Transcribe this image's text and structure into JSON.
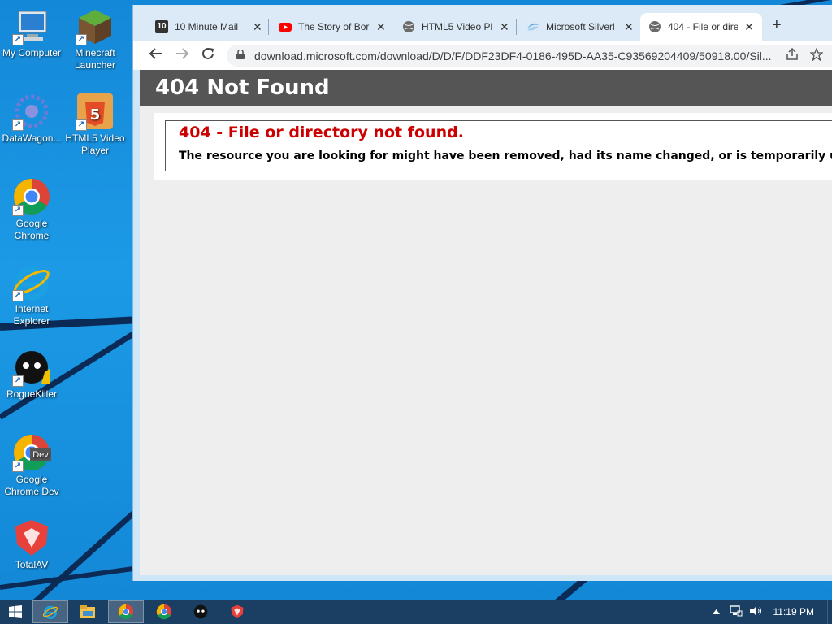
{
  "desktop": {
    "icons": [
      {
        "label": "My Computer",
        "icon": "computer-icon"
      },
      {
        "label": "Minecraft Launcher",
        "icon": "minecraft-icon"
      },
      {
        "label": "DataWagon...",
        "icon": "datawagon-icon"
      },
      {
        "label": "HTML5 Video Player",
        "icon": "html5-icon"
      },
      {
        "label": "Google Chrome",
        "icon": "chrome-icon"
      },
      {
        "label": "Internet Explorer",
        "icon": "ie-icon"
      },
      {
        "label": "RogueKiller",
        "icon": "roguekiller-icon"
      },
      {
        "label": "Google Chrome Dev",
        "icon": "chrome-dev-icon"
      },
      {
        "label": "TotalAV",
        "icon": "totalav-icon"
      }
    ]
  },
  "browser": {
    "tabs": [
      {
        "title": "10 Minute Mail",
        "icon": "tenminutemail-icon",
        "active": false
      },
      {
        "title": "The Story of Bor",
        "icon": "youtube-icon",
        "active": false
      },
      {
        "title": "HTML5 Video Pl",
        "icon": "globe-icon",
        "active": false
      },
      {
        "title": "Microsoft Silverl",
        "icon": "silverlight-icon",
        "active": false
      },
      {
        "title": "404 - File or dire",
        "icon": "globe-icon",
        "active": true
      }
    ],
    "new_tab_label": "+",
    "close_glyph": "✕",
    "url": "download.microsoft.com/download/D/D/F/DDF23DF4-0186-495D-AA35-C93569204409/50918.00/Sil...",
    "favicon_text": "10"
  },
  "page": {
    "header": "404 Not Found",
    "error_title": "404 - File or directory not found.",
    "error_description": "The resource you are looking for might have been removed, had its name changed, or is temporarily unavailable."
  },
  "taskbar": {
    "items": [
      "start-icon",
      "ie-icon",
      "file-explorer-icon",
      "chrome-icon",
      "chrome-dev-icon",
      "roguekiller-icon",
      "totalav-icon"
    ],
    "clock": "11:19 PM",
    "chrome_dev_badge": "Dev"
  },
  "colors": {
    "error_red": "#cc0000",
    "header_gray": "#555555",
    "taskbar": "#1a3f63"
  }
}
